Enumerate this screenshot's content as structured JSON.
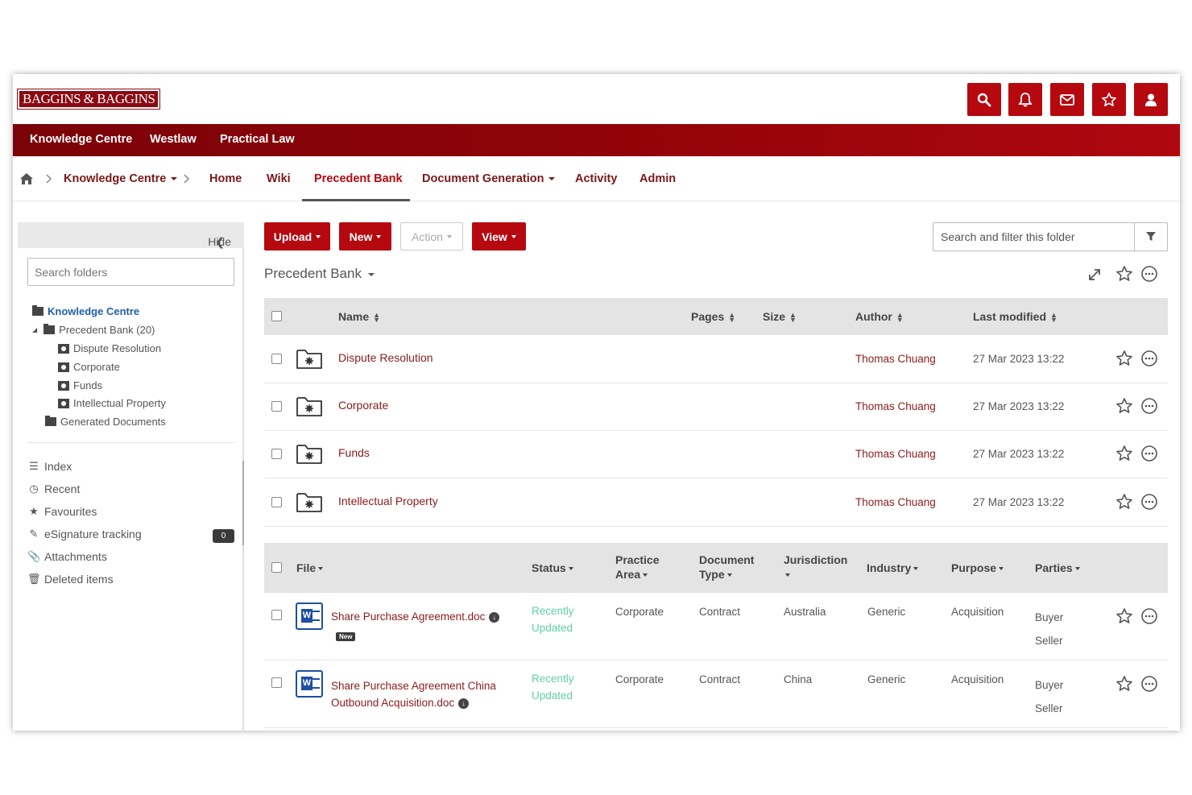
{
  "brand": {
    "logo_text": "BAGGINS & BAGGINS",
    "accent": "#b5090f"
  },
  "header_icons": [
    "search-icon",
    "bell-icon",
    "envelope-icon",
    "star-icon",
    "user-icon"
  ],
  "topnav": [
    "Knowledge Centre",
    "Westlaw",
    "Practical Law"
  ],
  "breadcrumb": {
    "current": "Knowledge Centre"
  },
  "subnav": [
    "Home",
    "Wiki",
    "Precedent Bank",
    "Document Generation",
    "Activity",
    "Admin"
  ],
  "subnav_active": "Precedent Bank",
  "sidebar": {
    "hide_label": "Hide",
    "search_placeholder": "Search folders",
    "tree": {
      "root": "Knowledge Centre",
      "precedent": "Precedent Bank (20)",
      "children": [
        "Dispute Resolution",
        "Corporate",
        "Funds",
        "Intellectual Property"
      ],
      "generated": "Generated Documents"
    },
    "links": [
      "Index",
      "Recent",
      "Favourites",
      "eSignature tracking",
      "Attachments",
      "Deleted items"
    ],
    "esign_count": "0"
  },
  "toolbar": {
    "upload": "Upload",
    "new": "New",
    "action": "Action",
    "view": "View",
    "filter_placeholder": "Search and filter this folder"
  },
  "page_title": "Precedent Bank",
  "folders_table": {
    "headers": {
      "name": "Name",
      "pages": "Pages",
      "size": "Size",
      "author": "Author",
      "modified": "Last modified"
    },
    "rows": [
      {
        "name": "Dispute Resolution",
        "author": "Thomas Chuang",
        "modified": "27 Mar 2023 13:22"
      },
      {
        "name": "Corporate",
        "author": "Thomas Chuang",
        "modified": "27 Mar 2023 13:22"
      },
      {
        "name": "Funds",
        "author": "Thomas Chuang",
        "modified": "27 Mar 2023 13:22"
      },
      {
        "name": "Intellectual Property",
        "author": "Thomas Chuang",
        "modified": "27 Mar 2023 13:22"
      }
    ]
  },
  "files_table": {
    "headers": {
      "file": "File",
      "status": "Status",
      "practice1": "Practice",
      "practice2": "Area",
      "doctype1": "Document",
      "doctype2": "Type",
      "jurisdiction": "Jurisdiction",
      "industry": "Industry",
      "purpose": "Purpose",
      "parties": "Parties"
    },
    "rows": [
      {
        "file1": "Share Purchase Agreement.doc",
        "file2": "",
        "badge": "New",
        "status1": "Recently",
        "status2": "Updated",
        "practice": "Corporate",
        "doctype": "Contract",
        "jurisdiction": "Australia",
        "industry": "Generic",
        "purpose": "Acquisition",
        "party1": "Buyer",
        "party2": "Seller"
      },
      {
        "file1": "Share Purchase Agreement China",
        "file2": "Outbound Acquisition.doc",
        "status1": "Recently",
        "status2": "Updated",
        "practice": "Corporate",
        "doctype": "Contract",
        "jurisdiction": "China",
        "industry": "Generic",
        "purpose": "Acquisition",
        "party1": "Buyer",
        "party2": "Seller"
      }
    ]
  }
}
